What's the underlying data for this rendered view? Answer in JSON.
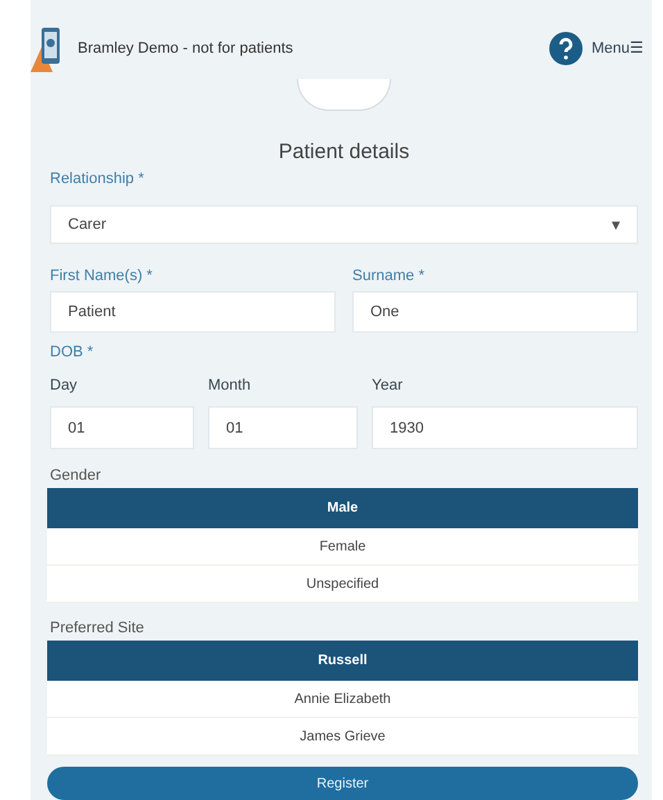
{
  "header": {
    "title": "Bramley Demo - not for patients",
    "menu_label": "Menu",
    "menu_glyph": "☰"
  },
  "page_title": "Patient details",
  "relationship": {
    "label": "Relationship *",
    "value": "Carer",
    "caret": "▾"
  },
  "name_fields": [
    {
      "label": "First Name(s) *",
      "value": "Patient"
    },
    {
      "label": "Surname *",
      "value": "One"
    }
  ],
  "dob": {
    "label": "DOB *",
    "parts": [
      {
        "label": "Day",
        "value": "01"
      },
      {
        "label": "Month",
        "value": "01"
      },
      {
        "label": "Year",
        "value": "1930"
      }
    ]
  },
  "gender": {
    "label": "Gender",
    "options": [
      {
        "label": "Male",
        "selected": true
      },
      {
        "label": "Female",
        "selected": false
      },
      {
        "label": "Unspecified",
        "selected": false
      }
    ]
  },
  "preferred_site": {
    "label": "Preferred Site",
    "options": [
      {
        "label": "Russell",
        "selected": true
      },
      {
        "label": "Annie Elizabeth",
        "selected": false
      },
      {
        "label": "James Grieve",
        "selected": false
      }
    ]
  },
  "register_button": "Register"
}
